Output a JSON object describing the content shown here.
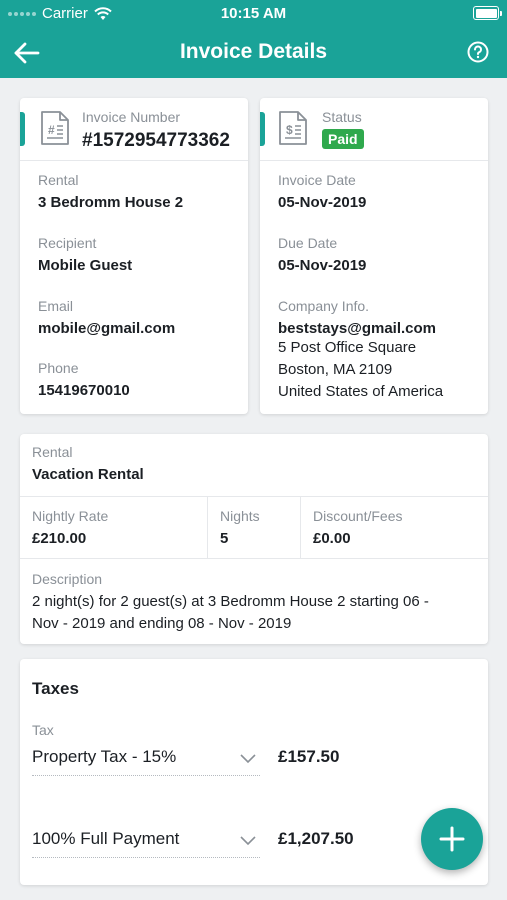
{
  "status_bar": {
    "carrier": "Carrier",
    "time": "10:15 AM"
  },
  "nav": {
    "title": "Invoice Details"
  },
  "invoice_card": {
    "number_label": "Invoice Number",
    "number_value": "#1572954773362",
    "rental_label": "Rental",
    "rental_value": "3 Bedromm House 2",
    "recipient_label": "Recipient",
    "recipient_value": "Mobile Guest",
    "email_label": "Email",
    "email_value": "mobile@gmail.com",
    "phone_label": "Phone",
    "phone_value": "15419670010"
  },
  "status_card": {
    "status_label": "Status",
    "status_value": "Paid",
    "invoice_date_label": "Invoice Date",
    "invoice_date_value": "05-Nov-2019",
    "due_date_label": "Due Date",
    "due_date_value": "05-Nov-2019",
    "company_label": "Company Info.",
    "company_email": "beststays@gmail.com",
    "company_address_1": "5 Post Office Square",
    "company_address_2": "Boston, MA 2109",
    "company_address_3": "United States of America"
  },
  "rental_card": {
    "rental_label": "Rental",
    "rental_value": "Vacation Rental",
    "nightly_rate_label": "Nightly Rate",
    "nightly_rate_value": "£210.00",
    "nights_label": "Nights",
    "nights_value": "5",
    "discount_label": "Discount/Fees",
    "discount_value": "£0.00",
    "description_label": "Description",
    "description_line_1": "2 night(s) for 2 guest(s) at 3 Bedromm House 2 starting 06 -",
    "description_line_2": "Nov - 2019 and ending 08 - Nov - 2019"
  },
  "taxes_card": {
    "title": "Taxes",
    "tax_label": "Tax",
    "tax_select_value": "Property Tax - 15%",
    "tax_amount": "£157.50",
    "payment_select_value": "100% Full Payment",
    "payment_amount": "£1,207.50"
  },
  "colors": {
    "primary": "#1aa398",
    "paid_badge": "#2fa94d",
    "text": "#1b1f24",
    "muted": "#8a9097"
  }
}
